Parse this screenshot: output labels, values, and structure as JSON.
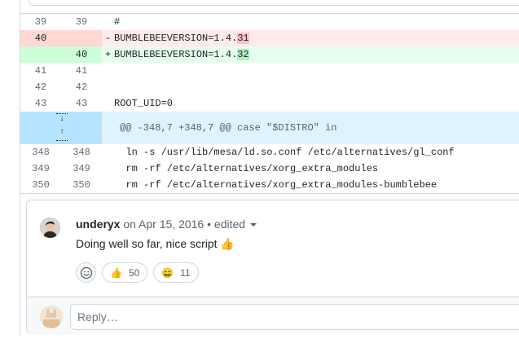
{
  "diff": {
    "context_before": [
      {
        "old": "39",
        "new": "39",
        "code": "#"
      }
    ],
    "deleted": {
      "old": "40",
      "marker": "-",
      "code_prefix": "BUMBLEBEEVERSION=1.4.",
      "code_change": "31"
    },
    "added": {
      "new": "40",
      "marker": "+",
      "code_prefix": "BUMBLEBEEVERSION=1.4.",
      "code_change": "32"
    },
    "context_after": [
      {
        "old": "41",
        "new": "41",
        "code": ""
      },
      {
        "old": "42",
        "new": "42",
        "code": ""
      },
      {
        "old": "43",
        "new": "43",
        "code": "ROOT_UID=0"
      }
    ],
    "hunk_header": "@@ -348,7 +348,7 @@ case \"$DISTRO\" in",
    "context_tail": [
      {
        "old": "348",
        "new": "348",
        "code": "  ln -s /usr/lib/mesa/ld.so.conf /etc/alternatives/gl_conf"
      },
      {
        "old": "349",
        "new": "349",
        "code": "  rm -rf /etc/alternatives/xorg_extra_modules"
      },
      {
        "old": "350",
        "new": "350",
        "code": "  rm -rf /etc/alternatives/xorg_extra_modules-bumblebee"
      }
    ]
  },
  "comment": {
    "author": "underyx",
    "date_text": "on Apr 15, 2016",
    "separator": "•",
    "edited_label": "edited",
    "body": "Doing well so far, nice script 👍",
    "reactions": [
      {
        "emoji": "👍",
        "icon": "thumbs-up-icon",
        "count": "50"
      },
      {
        "emoji": "😄",
        "icon": "smile-icon",
        "count": "11"
      }
    ]
  },
  "reply": {
    "placeholder": "Reply…"
  },
  "colors": {
    "deleted_bg": "#ffebe9",
    "added_bg": "#e6ffec",
    "hunk_bg": "#ddf4ff",
    "border": "#d0d7de"
  }
}
